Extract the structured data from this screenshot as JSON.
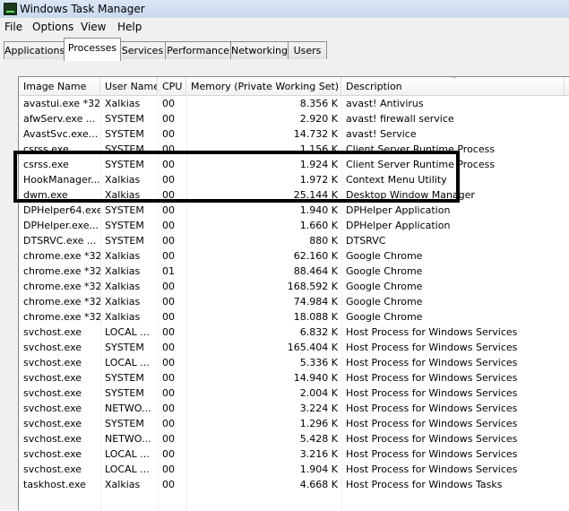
{
  "window": {
    "title": "Windows Task Manager",
    "icon": "task-manager-icon"
  },
  "menu": {
    "items": [
      "File",
      "Options",
      "View",
      "Help"
    ]
  },
  "tabs": [
    "Applications",
    "Processes",
    "Services",
    "Performance",
    "Networking",
    "Users"
  ],
  "active_tab": "Processes",
  "columns": [
    "Image Name",
    "User Name",
    "CPU",
    "Memory (Private Working Set)",
    "Description"
  ],
  "sort_indicator": "^",
  "rows": [
    {
      "image": "avastui.exe *32",
      "user": "Xalkias",
      "cpu": "00",
      "mem": "8.356 K",
      "desc": "avast! Antivirus"
    },
    {
      "image": "afwServ.exe ...",
      "user": "SYSTEM",
      "cpu": "00",
      "mem": "2.920 K",
      "desc": "avast! firewall service"
    },
    {
      "image": "AvastSvc.exe...",
      "user": "SYSTEM",
      "cpu": "00",
      "mem": "14.732 K",
      "desc": "avast! Service"
    },
    {
      "image": "csrss.exe",
      "user": "SYSTEM",
      "cpu": "00",
      "mem": "1.156 K",
      "desc": "Client Server Runtime Process"
    },
    {
      "image": "csrss.exe",
      "user": "SYSTEM",
      "cpu": "00",
      "mem": "1.924 K",
      "desc": "Client Server Runtime Process"
    },
    {
      "image": "HookManager...",
      "user": "Xalkias",
      "cpu": "00",
      "mem": "1.972 K",
      "desc": "Context Menu Utility"
    },
    {
      "image": "dwm.exe",
      "user": "Xalkias",
      "cpu": "00",
      "mem": "25.144 K",
      "desc": "Desktop Window Manager"
    },
    {
      "image": "DPHelper64.exe",
      "user": "SYSTEM",
      "cpu": "00",
      "mem": "1.940 K",
      "desc": "DPHelper Application"
    },
    {
      "image": "DPHelper.exe...",
      "user": "SYSTEM",
      "cpu": "00",
      "mem": "1.660 K",
      "desc": "DPHelper Application"
    },
    {
      "image": "DTSRVC.exe ...",
      "user": "SYSTEM",
      "cpu": "00",
      "mem": "880 K",
      "desc": "DTSRVC"
    },
    {
      "image": "chrome.exe *32",
      "user": "Xalkias",
      "cpu": "00",
      "mem": "62.160 K",
      "desc": "Google Chrome"
    },
    {
      "image": "chrome.exe *32",
      "user": "Xalkias",
      "cpu": "01",
      "mem": "88.464 K",
      "desc": "Google Chrome"
    },
    {
      "image": "chrome.exe *32",
      "user": "Xalkias",
      "cpu": "00",
      "mem": "168.592 K",
      "desc": "Google Chrome"
    },
    {
      "image": "chrome.exe *32",
      "user": "Xalkias",
      "cpu": "00",
      "mem": "74.984 K",
      "desc": "Google Chrome"
    },
    {
      "image": "chrome.exe *32",
      "user": "Xalkias",
      "cpu": "00",
      "mem": "18.088 K",
      "desc": "Google Chrome"
    },
    {
      "image": "svchost.exe",
      "user": "LOCAL ...",
      "cpu": "00",
      "mem": "6.832 K",
      "desc": "Host Process for Windows Services"
    },
    {
      "image": "svchost.exe",
      "user": "SYSTEM",
      "cpu": "00",
      "mem": "165.404 K",
      "desc": "Host Process for Windows Services"
    },
    {
      "image": "svchost.exe",
      "user": "LOCAL ...",
      "cpu": "00",
      "mem": "5.336 K",
      "desc": "Host Process for Windows Services"
    },
    {
      "image": "svchost.exe",
      "user": "SYSTEM",
      "cpu": "00",
      "mem": "14.940 K",
      "desc": "Host Process for Windows Services"
    },
    {
      "image": "svchost.exe",
      "user": "SYSTEM",
      "cpu": "00",
      "mem": "2.004 K",
      "desc": "Host Process for Windows Services"
    },
    {
      "image": "svchost.exe",
      "user": "NETWO...",
      "cpu": "00",
      "mem": "3.224 K",
      "desc": "Host Process for Windows Services"
    },
    {
      "image": "svchost.exe",
      "user": "SYSTEM",
      "cpu": "00",
      "mem": "1.296 K",
      "desc": "Host Process for Windows Services"
    },
    {
      "image": "svchost.exe",
      "user": "NETWO...",
      "cpu": "00",
      "mem": "5.428 K",
      "desc": "Host Process for Windows Services"
    },
    {
      "image": "svchost.exe",
      "user": "LOCAL ...",
      "cpu": "00",
      "mem": "3.216 K",
      "desc": "Host Process for Windows Services"
    },
    {
      "image": "svchost.exe",
      "user": "LOCAL ...",
      "cpu": "00",
      "mem": "1.904 K",
      "desc": "Host Process for Windows Services"
    },
    {
      "image": "taskhost.exe",
      "user": "Xalkias",
      "cpu": "00",
      "mem": "4.668 K",
      "desc": "Host Process for Windows Tasks"
    }
  ],
  "highlighted_rows": 3
}
